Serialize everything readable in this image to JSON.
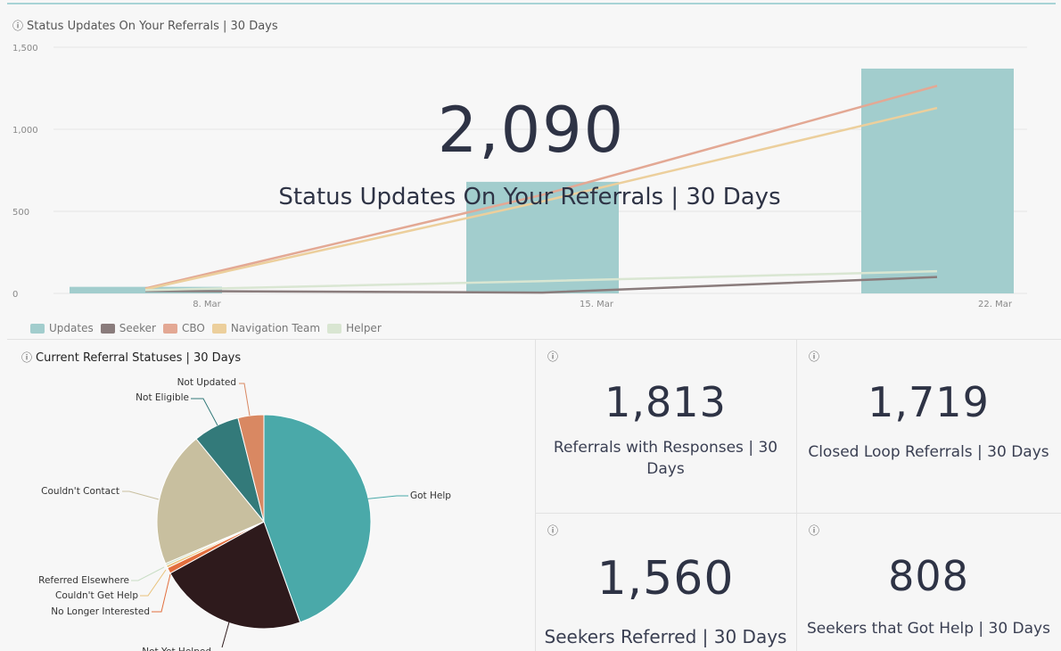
{
  "top_panel": {
    "title": "Status Updates On Your Referrals | 30 Days",
    "overlay_value": "2,090",
    "overlay_label": "Status Updates On Your Referrals | 30 Days"
  },
  "chart_data": [
    {
      "type": "bar+line",
      "title": "Status Updates On Your Referrals | 30 Days",
      "ylim": [
        0,
        1500
      ],
      "yticks": [
        "0",
        "500",
        "1,000",
        "1,500"
      ],
      "categories": [
        "8. Mar",
        "15. Mar",
        "22. Mar"
      ],
      "legend_placement": "bottom-left",
      "series": [
        {
          "name": "Updates",
          "type": "bar",
          "color": "#a2cdcd",
          "values": [
            40,
            680,
            1370
          ]
        },
        {
          "name": "Seeker",
          "type": "line",
          "color": "#8a7c7c",
          "values": [
            15,
            5,
            100
          ]
        },
        {
          "name": "CBO",
          "type": "line",
          "color": "#e3a894",
          "values": [
            30,
            600,
            1265
          ]
        },
        {
          "name": "Navigation Team",
          "type": "line",
          "color": "#eccf9c",
          "values": [
            25,
            560,
            1130
          ]
        },
        {
          "name": "Helper",
          "type": "line",
          "color": "#d9e6d2",
          "values": [
            20,
            75,
            135
          ]
        }
      ]
    },
    {
      "type": "pie",
      "title": "Current Referral Statuses | 30 Days",
      "slices": [
        {
          "label": "Got Help",
          "value": 44.5,
          "color": "#4aa9a9"
        },
        {
          "label": "Not Yet Helped",
          "value": 22.5,
          "color": "#2e1a1c"
        },
        {
          "label": "No Longer Interested",
          "value": 0.9,
          "color": "#e26f3e"
        },
        {
          "label": "Couldn't Get Help",
          "value": 0.4,
          "color": "#e9c27b"
        },
        {
          "label": "Referred Elsewhere",
          "value": 0.3,
          "color": "#c9dec5"
        },
        {
          "label": "Couldn't Contact",
          "value": 20.5,
          "color": "#c8bf9f"
        },
        {
          "label": "Not Eligible",
          "value": 7.0,
          "color": "#337a7a"
        },
        {
          "label": "Not Updated",
          "value": 3.9,
          "color": "#d98862"
        }
      ]
    }
  ],
  "pie_panel": {
    "title": "Current Referral Statuses | 30 Days",
    "labels": {
      "got_help": "Got Help",
      "not_yet_helped": "Not Yet Helped",
      "no_longer_interested": "No Longer Interested",
      "couldnt_get_help": "Couldn't Get Help",
      "referred_elsewhere": "Referred Elsewhere",
      "couldnt_contact": "Couldn't Contact",
      "not_eligible": "Not Eligible",
      "not_updated": "Not Updated"
    }
  },
  "kpis": [
    {
      "value": "1,813",
      "label": "Referrals with Responses | 30 Days"
    },
    {
      "value": "1,719",
      "label": "Closed Loop Referrals | 30 Days"
    },
    {
      "value": "1,560",
      "label": "Seekers Referred | 30 Days"
    },
    {
      "value": "808",
      "label": "Seekers that Got Help | 30 Days"
    }
  ],
  "info_glyph": "ⓘ",
  "icons": {
    "info": "info-circle-icon"
  }
}
